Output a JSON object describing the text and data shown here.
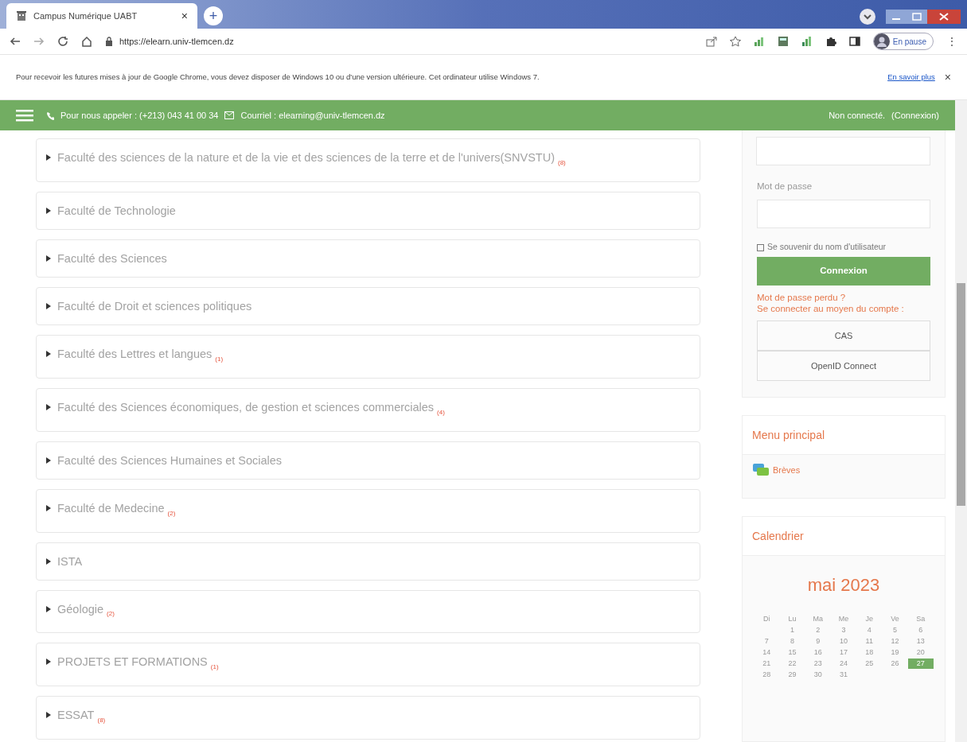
{
  "browser": {
    "tab_title": "Campus Numérique UABT",
    "tab_close": "×",
    "new_tab": "+",
    "url": "https://elearn.univ-tlemcen.dz",
    "profile": "En pause",
    "menu": "⋮"
  },
  "infobar": {
    "message": "Pour recevoir les futures mises à jour de Google Chrome, vous devez disposer de Windows 10 ou d'une version ultérieure. Cet ordinateur utilise Windows 7.",
    "link": "En savoir plus",
    "close": "×"
  },
  "topbar": {
    "phone": "Pour nous appeler : (+213) 043 41 00 34",
    "email": "Courriel : elearning@univ-tlemcen.dz",
    "status": "Non connecté.",
    "login_link": "(Connexion)"
  },
  "categories": [
    {
      "name": "Faculté des sciences de la nature et de la vie et des sciences de la terre et de l'univers(SNVSTU)",
      "count": "(8)"
    },
    {
      "name": "Faculté de Technologie"
    },
    {
      "name": "Faculté des Sciences"
    },
    {
      "name": "Faculté de Droit et sciences politiques"
    },
    {
      "name": "Faculté des Lettres et langues",
      "count": "(1)"
    },
    {
      "name": "Faculté des Sciences économiques, de gestion et sciences commerciales",
      "count": "(4)"
    },
    {
      "name": "Faculté des Sciences Humaines et Sociales"
    },
    {
      "name": "Faculté de Medecine",
      "count": "(2)"
    },
    {
      "name": "ISTA"
    },
    {
      "name": "Géologie",
      "count": "(2)"
    },
    {
      "name": "PROJETS ET FORMATIONS",
      "count": "(1)"
    },
    {
      "name": "ESSAT",
      "count": "(8)"
    }
  ],
  "login": {
    "password_label": "Mot de passe",
    "remember": {
      "label": "Se souvenir du nom d'utilisateur",
      "checked": false
    },
    "submit": "Connexion",
    "lost_password": "Mot de passe perdu ?",
    "alt_login": "Se connecter au moyen du compte :",
    "providers": [
      "CAS",
      "OpenID Connect"
    ]
  },
  "main_menu": {
    "title": "Menu principal",
    "items": [
      "Brèves"
    ]
  },
  "calendar": {
    "title": "Calendrier",
    "month": "mai 2023",
    "weekdays": [
      "Di",
      "Lu",
      "Ma",
      "Me",
      "Je",
      "Ve",
      "Sa"
    ],
    "weeks": [
      {
        "days": [
          {
            "label": "1",
            "today": false
          },
          {
            "label": "2",
            "today": false
          },
          {
            "label": "3",
            "today": false
          },
          {
            "label": "4",
            "today": false
          },
          {
            "label": "5",
            "today": false
          },
          {
            "label": "6",
            "today": false
          }
        ]
      },
      {
        "days": [
          {
            "label": "7",
            "today": false
          },
          {
            "label": "8",
            "today": false
          },
          {
            "label": "9",
            "today": false
          },
          {
            "label": "10",
            "today": false
          },
          {
            "label": "11",
            "today": false
          },
          {
            "label": "12",
            "today": false
          },
          {
            "label": "13",
            "today": false
          }
        ]
      },
      {
        "days": [
          {
            "label": "14",
            "today": false
          },
          {
            "label": "15",
            "today": false
          },
          {
            "label": "16",
            "today": false
          },
          {
            "label": "17",
            "today": false
          },
          {
            "label": "18",
            "today": false
          },
          {
            "label": "19",
            "today": false
          },
          {
            "label": "20",
            "today": false
          }
        ]
      },
      {
        "days": [
          {
            "label": "21",
            "today": false
          },
          {
            "label": "22",
            "today": false
          },
          {
            "label": "23",
            "today": false
          },
          {
            "label": "24",
            "today": false
          },
          {
            "label": "25",
            "today": false
          },
          {
            "label": "26",
            "today": false
          },
          {
            "label": "27",
            "today": true
          }
        ]
      },
      {
        "days": [
          {
            "label": "28",
            "today": false
          },
          {
            "label": "29",
            "today": false
          },
          {
            "label": "30",
            "today": false
          },
          {
            "label": "31",
            "today": false
          }
        ]
      }
    ]
  }
}
